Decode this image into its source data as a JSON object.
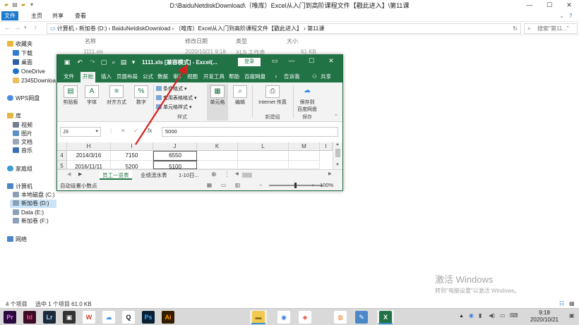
{
  "explorer": {
    "title": "D:\\BaiduNetdiskDownload\\（唯库）Excel从入门到高阶课程文件【戳此进入】\\第11课",
    "ribbon_tabs": [
      "文件",
      "主页",
      "共享",
      "查看"
    ],
    "address_parts": [
      "计算机",
      "新加卷 (D:)",
      "BaiduNetdiskDownload",
      "（唯库）Excel从入门到高阶课程文件【戳此进入】",
      "第11课"
    ],
    "search_placeholder": "搜索\"第11...\"",
    "nav": {
      "favorites": "收藏夹",
      "downloads": "下载",
      "desktop": "桌面",
      "onedrive": "OneDrive",
      "d2345": "2345Downloa",
      "wps": "WPS网盘",
      "library": "库",
      "video": "视频",
      "pictures": "图片",
      "documents": "文档",
      "music": "音乐",
      "homegroup": "家庭组",
      "computer": "计算机",
      "disk_c": "本地磁盘 (C:)",
      "disk_d": "新加卷 (D:)",
      "disk_e": "Data (E:)",
      "disk_f": "新加卷 (F:)",
      "network": "网络"
    },
    "headers": {
      "name": "名称",
      "date": "修改日期",
      "type": "类型",
      "size": "大小"
    },
    "file": {
      "name": "1111.xls",
      "date": "2020/10/21 9:18",
      "type": "XLS 工作表",
      "size": "61 KB"
    },
    "status": {
      "count": "4 个项目",
      "selected": "选中 1 个项目  61.0 KB"
    }
  },
  "activate": {
    "line1": "激活 Windows",
    "line2": "转到\"电脑设置\"以激活 Windows。"
  },
  "excel": {
    "title": "1111.xls  [兼容模式]  -  Excel(...",
    "login": "登录",
    "tabs": [
      "文件",
      "开始",
      "插入",
      "页面布局",
      "公式",
      "数据",
      "审阅",
      "视图",
      "开发工具",
      "帮助",
      "百度网盘",
      "告诉我",
      "共享"
    ],
    "ribbon": {
      "clipboard": "剪贴板",
      "font": "字体",
      "align": "对齐方式",
      "number": "数字",
      "cond_format": "条件格式",
      "table_format": "套用表格格式",
      "cell_style": "单元格样式",
      "styles": "样式",
      "cells": "单元格",
      "editing": "编辑",
      "internet": "Internet 传真",
      "new_group": "新建组",
      "save_to": "保存到",
      "baidu": "百度网盘",
      "save": "保存"
    },
    "namebox": "J9",
    "formula": "5000",
    "columns": [
      "H",
      "I",
      "J",
      "K",
      "L",
      "M",
      "I"
    ],
    "rows": [
      {
        "num": "4",
        "h": "2014/3/16",
        "i": "7150",
        "j": "6550"
      },
      {
        "num": "5",
        "h": "2016/11/11",
        "i": "5200",
        "j": "5100"
      }
    ],
    "sheets": [
      "员工一览表",
      "业绩流水表",
      "1-10日..."
    ],
    "status_left": "自动设置小数点",
    "zoom": "100%"
  },
  "taskbar": {
    "apps": [
      {
        "name": "premiere",
        "label": "Pr",
        "bg": "#2a0a3d",
        "fg": "#e77cff"
      },
      {
        "name": "indesign",
        "label": "Id",
        "bg": "#3d0b25",
        "fg": "#ff3d8d"
      },
      {
        "name": "lightroom",
        "label": "Lr",
        "bg": "#1b2a3a",
        "fg": "#9fd1ff"
      },
      {
        "name": "media",
        "label": "▣",
        "bg": "#333333",
        "fg": "#ffffff"
      },
      {
        "name": "wps",
        "label": "W",
        "bg": "#ffffff",
        "fg": "#d23a2a"
      },
      {
        "name": "baidu-netdisk",
        "label": "☁",
        "bg": "#ffffff",
        "fg": "#2d8cf0"
      },
      {
        "name": "qq",
        "label": "Q",
        "bg": "#ffffff",
        "fg": "#111111"
      },
      {
        "name": "photoshop",
        "label": "Ps",
        "bg": "#0a1f33",
        "fg": "#31a8ff"
      },
      {
        "name": "illustrator",
        "label": "Ai",
        "bg": "#331c00",
        "fg": "#ff9a00"
      },
      {
        "name": "explorer",
        "label": "▬",
        "bg": "#f2c94c",
        "fg": "#8a6d1f"
      },
      {
        "name": "chrome",
        "label": "◉",
        "bg": "#ffffff",
        "fg": "#3a7fd5"
      },
      {
        "name": "wps-office",
        "label": "◈",
        "bg": "#ffffff",
        "fg": "#e0462c"
      },
      {
        "name": "firefox",
        "label": "◍",
        "bg": "#ffffff",
        "fg": "#f07a1c"
      },
      {
        "name": "notes",
        "label": "✎",
        "bg": "#4a88c9",
        "fg": "#ffffff"
      },
      {
        "name": "excel",
        "label": "X",
        "bg": "#217346",
        "fg": "#ffffff"
      }
    ],
    "clock_time": "9:18",
    "clock_date": "2020/10/21"
  }
}
